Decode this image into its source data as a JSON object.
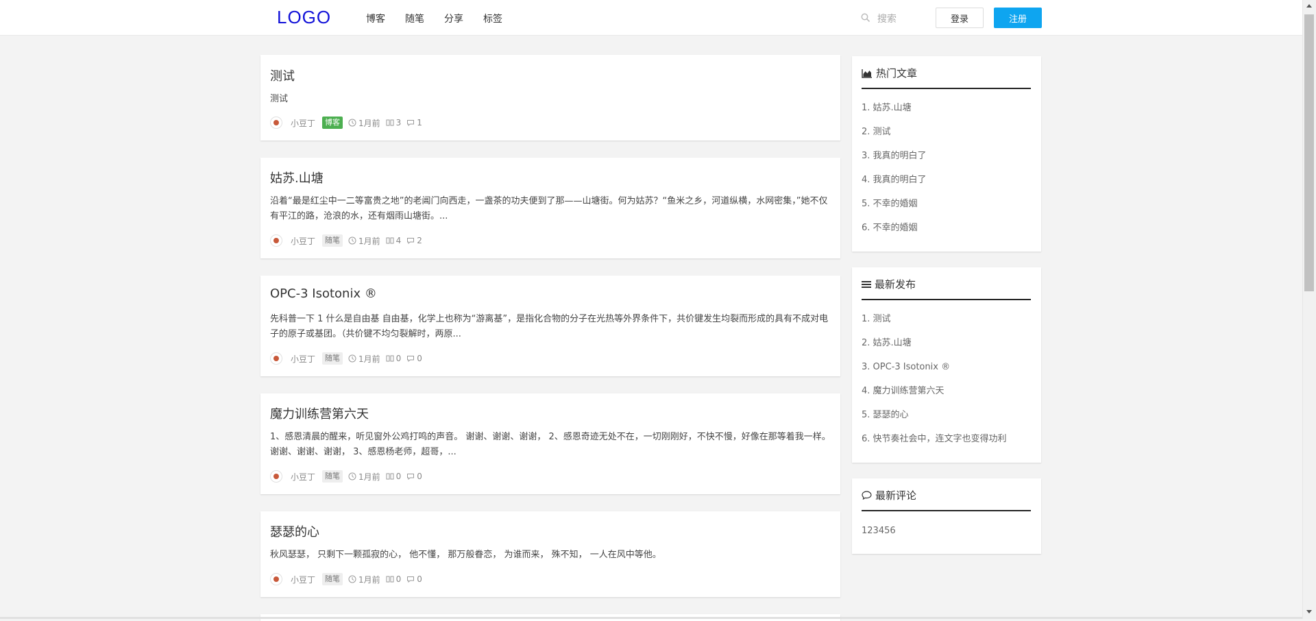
{
  "header": {
    "logo": "LOGO",
    "nav": [
      "博客",
      "随笔",
      "分享",
      "标签"
    ],
    "search_placeholder": "搜索",
    "login_label": "登录",
    "register_label": "注册"
  },
  "articles": [
    {
      "title": "测试",
      "summary": "测试",
      "author": "小豆丁",
      "category": "博客",
      "category_style": "green",
      "time": "1月前",
      "views": "3",
      "comments": "1"
    },
    {
      "title": "姑苏.山塘",
      "summary": "沿着“最是红尘中一二等富贵之地”的老阊门向西走，一盏茶的功夫便到了那——山塘街。何为姑苏？“鱼米之乡，河道纵横，水网密集，”她不仅有平江的路，沧浪的水，还有烟雨山塘街。...",
      "author": "小豆丁",
      "category": "随笔",
      "category_style": "gray",
      "time": "1月前",
      "views": "4",
      "comments": "2"
    },
    {
      "title": "OPC-3 Isotonix ®",
      "summary": "先科普一下 1 什么是自由基 自由基，化学上也称为“游离基”，是指化合物的分子在光热等外界条件下，共价键发生均裂而形成的具有不成对电子的原子或基团。（共价键不均匀裂解时，两原...",
      "author": "小豆丁",
      "category": "随笔",
      "category_style": "gray",
      "time": "1月前",
      "views": "0",
      "comments": "0"
    },
    {
      "title": "魔力训练营第六天",
      "summary": "1、感恩清晨的醒来，听见窗外公鸡打鸣的声音。 谢谢、谢谢、谢谢， 2、感恩奇迹无处不在，一切刚刚好，不快不慢，好像在那等着我一样。 谢谢、谢谢、谢谢， 3、感恩杨老师，超哥，...",
      "author": "小豆丁",
      "category": "随笔",
      "category_style": "gray",
      "time": "1月前",
      "views": "0",
      "comments": "0"
    },
    {
      "title": "瑟瑟的心",
      "summary": "秋风瑟瑟， 只剩下一颗孤寂的心， 他不懂， 那万般眷恋， 为谁而来， 殊不知， 一人在风中等他。",
      "author": "小豆丁",
      "category": "随笔",
      "category_style": "gray",
      "time": "1月前",
      "views": "0",
      "comments": "0"
    }
  ],
  "sidebar": {
    "hot": {
      "title": "热门文章",
      "items": [
        "1. 姑苏.山塘",
        "2. 测试",
        "3. 我真的明白了",
        "4. 我真的明白了",
        "5. 不幸的婚姻",
        "6. 不幸的婚姻"
      ]
    },
    "latest": {
      "title": "最新发布",
      "items": [
        "1. 测试",
        "2. 姑苏.山塘",
        "3. OPC-3 Isotonix ®",
        "4. 魔力训练营第六天",
        "5. 瑟瑟的心",
        "6. 快节奏社会中，连文字也变得功利"
      ]
    },
    "comments": {
      "title": "最新评论",
      "items": [
        "123456"
      ]
    }
  },
  "colors": {
    "accent": "#0ea5f0",
    "logo": "#1010d8",
    "tag_green": "#4caf50"
  }
}
